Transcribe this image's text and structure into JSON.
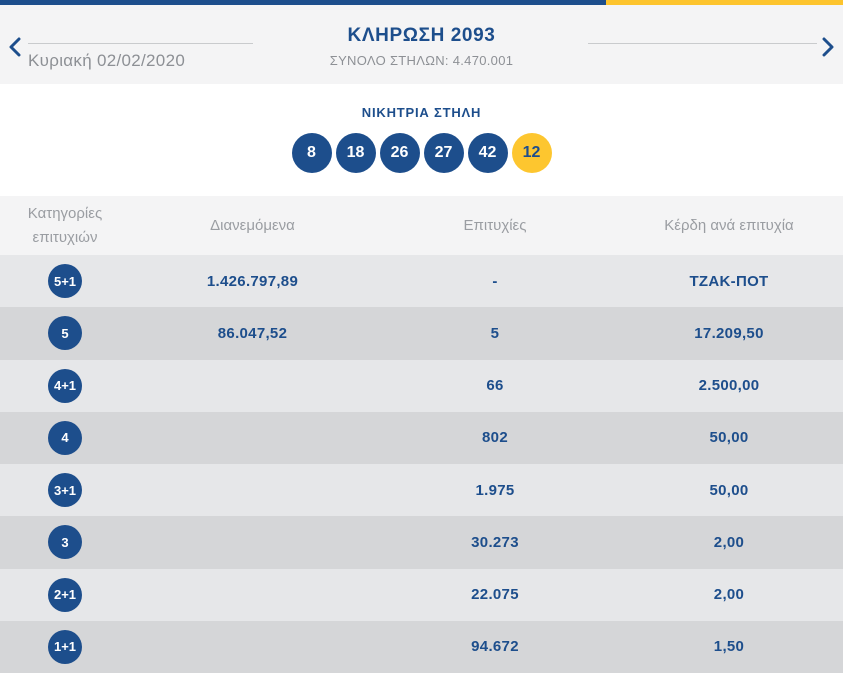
{
  "colors": {
    "primary_blue": "#1d4e8c",
    "accent_yellow": "#fdc42d",
    "bonus_ball_yellow": "#fdc62f",
    "header_band_gray": "#f4f4f5",
    "row_light_gray": "#e6e7e9",
    "row_dark_gray": "#d5d6d8",
    "muted_text_gray": "#8d9095"
  },
  "header": {
    "title": "ΚΛΗΡΩΣΗ 2093",
    "subtitle": "ΣΥΝΟΛΟ ΣΤΗΛΩΝ: 4.470.001",
    "date": "Κυριακή 02/02/2020",
    "prev_icon": "chevron-left",
    "next_icon": "chevron-right"
  },
  "winning": {
    "label": "ΝΙΚΗΤΡΙΑ ΣΤΗΛΗ",
    "numbers": [
      {
        "value": "8",
        "type": "main"
      },
      {
        "value": "18",
        "type": "main"
      },
      {
        "value": "26",
        "type": "main"
      },
      {
        "value": "27",
        "type": "main"
      },
      {
        "value": "42",
        "type": "main"
      },
      {
        "value": "12",
        "type": "bonus"
      }
    ]
  },
  "table": {
    "columns": {
      "category": "Κατηγορίες επιτυχιών",
      "distributed": "Διανεμόμενα",
      "winners": "Επιτυχίες",
      "payout": "Κέρδη ανά επιτυχία"
    },
    "rows": [
      {
        "category": "5+1",
        "distributed": "1.426.797,89",
        "winners": "-",
        "payout": "ΤΖΑΚ-ΠΟΤ"
      },
      {
        "category": "5",
        "distributed": "86.047,52",
        "winners": "5",
        "payout": "17.209,50"
      },
      {
        "category": "4+1",
        "distributed": "",
        "winners": "66",
        "payout": "2.500,00"
      },
      {
        "category": "4",
        "distributed": "",
        "winners": "802",
        "payout": "50,00"
      },
      {
        "category": "3+1",
        "distributed": "",
        "winners": "1.975",
        "payout": "50,00"
      },
      {
        "category": "3",
        "distributed": "",
        "winners": "30.273",
        "payout": "2,00"
      },
      {
        "category": "2+1",
        "distributed": "",
        "winners": "22.075",
        "payout": "2,00"
      },
      {
        "category": "1+1",
        "distributed": "",
        "winners": "94.672",
        "payout": "1,50"
      }
    ]
  }
}
